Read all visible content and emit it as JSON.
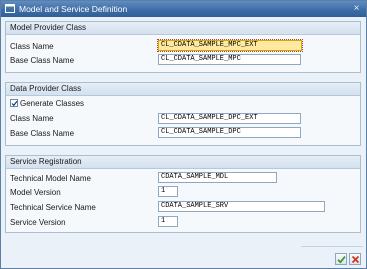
{
  "window": {
    "title": "Model and Service Definition",
    "close_glyph": "×"
  },
  "model_provider": {
    "header": "Model Provider Class",
    "class_name_label": "Class Name",
    "class_name_value": "CL_CDATA_SAMPLE_MPC_EXT",
    "base_class_label": "Base Class Name",
    "base_class_value": "CL_CDATA_SAMPLE_MPC"
  },
  "data_provider": {
    "header": "Data Provider Class",
    "generate_classes_label": "Generate Classes",
    "generate_classes_checked": true,
    "class_name_label": "Class Name",
    "class_name_value": "CL_CDATA_SAMPLE_DPC_EXT",
    "base_class_label": "Base Class Name",
    "base_class_value": "CL_CDATA_SAMPLE_DPC"
  },
  "service_registration": {
    "header": "Service Registration",
    "technical_model_label": "Technical Model Name",
    "technical_model_value": "CDATA_SAMPLE_MDL",
    "model_version_label": "Model Version",
    "model_version_value": "1",
    "technical_service_label": "Technical Service Name",
    "technical_service_value": "CDATA_SAMPLE_SRV",
    "service_version_label": "Service Version",
    "service_version_value": "1"
  },
  "footer": {
    "confirm_icon": "green-checkmark-icon",
    "cancel_icon": "red-x-icon"
  },
  "colors": {
    "titlebar": "#3f6ea6",
    "focused_field": "#fde9a1",
    "confirm": "#3a9a2a",
    "cancel": "#d03a20"
  }
}
